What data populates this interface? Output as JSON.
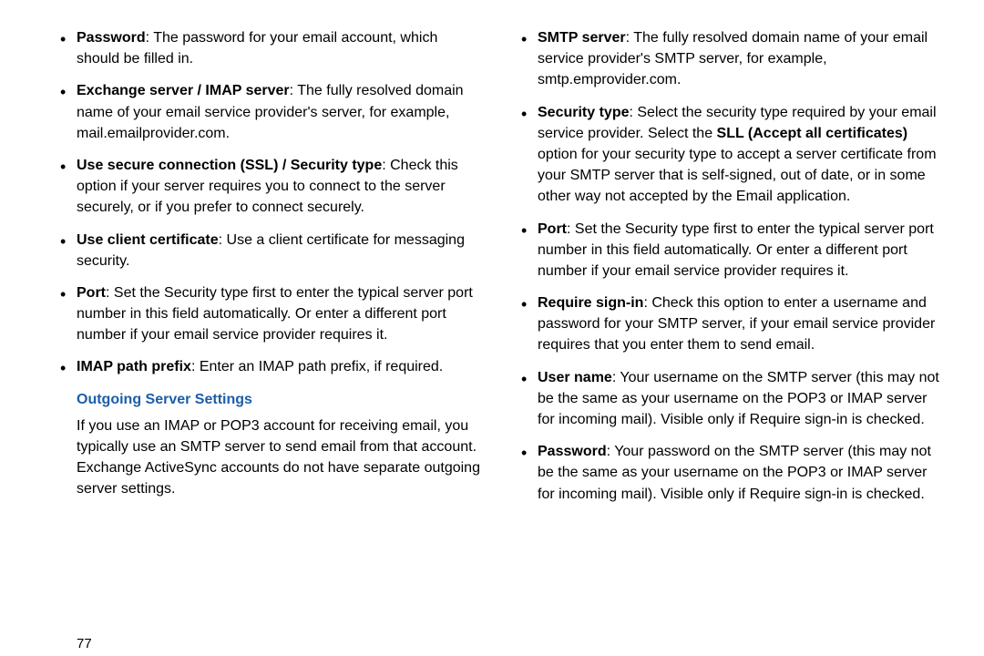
{
  "page_number": "77",
  "left": {
    "items": [
      {
        "term": "Password",
        "desc": ": The password for your email account, which should be filled in."
      },
      {
        "term": "Exchange server / IMAP server",
        "desc": ": The fully resolved domain name of your email service provider's server, for example, mail.emailprovider.com."
      },
      {
        "term": "Use secure connection (SSL) / Security type",
        "desc": ": Check this option if your server requires you to connect to the server securely, or if you prefer to connect securely."
      },
      {
        "term": "Use client certificate",
        "desc": ": Use a client certificate for messaging security."
      },
      {
        "term": "Port",
        "desc": ": Set the Security type first to enter the typical server port number in this field automatically. Or enter a different port number if your email service provider requires it."
      },
      {
        "term": "IMAP path prefix",
        "desc": ": Enter an IMAP path prefix, if required."
      }
    ],
    "heading": "Outgoing Server Settings",
    "paragraph": "If you use an IMAP or POP3 account for receiving email, you typically use an SMTP server to send email from that account. Exchange ActiveSync accounts do not have separate outgoing server settings."
  },
  "right": {
    "items": [
      {
        "term": "SMTP server",
        "desc": ": The fully resolved domain name of your email service provider's SMTP server, for example, smtp.emprovider.com."
      },
      {
        "term": "Security type",
        "pre": ": Select the security type required by your email service provider. Select the ",
        "bold": "SLL (Accept all certificates)",
        "post": " option for your security type to accept a server certificate from your SMTP server that is self-signed, out of date, or in some other way not accepted by the Email application."
      },
      {
        "term": "Port",
        "desc": ": Set the Security type first to enter the typical server port number in this field automatically. Or enter a different port number if your email service provider requires it."
      },
      {
        "term": "Require sign-in",
        "desc": ": Check this option to enter a username and password for your SMTP server, if your email service provider requires that you enter them to send email."
      },
      {
        "term": "User name",
        "desc": ": Your username on the SMTP server (this may not be the same as your username on the POP3 or IMAP server for incoming mail). Visible only if Require sign-in is checked."
      },
      {
        "term": "Password",
        "desc": ": Your password on the SMTP server (this may not be the same as your username on the POP3 or IMAP server for incoming mail). Visible only if Require sign-in is checked."
      }
    ]
  }
}
